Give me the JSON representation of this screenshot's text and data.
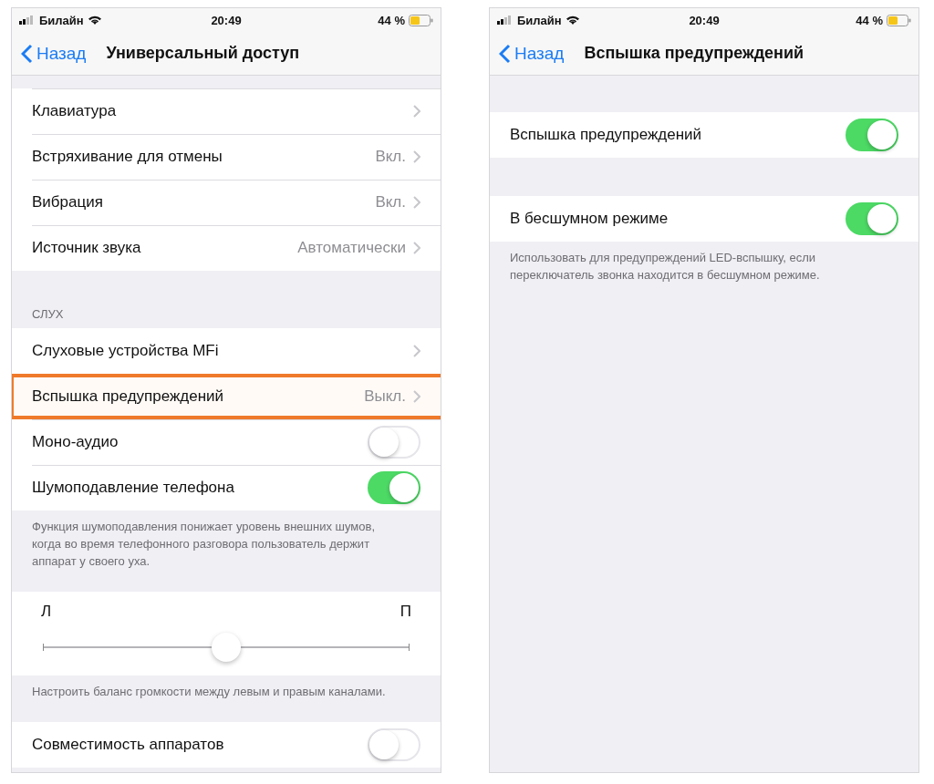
{
  "screens": [
    {
      "status_bar": {
        "carrier": "Билайн",
        "time": "20:49",
        "battery": "44 %"
      },
      "nav": {
        "back": "Назад",
        "title": "Универсальный доступ"
      },
      "sections": [
        {
          "rows": [
            {
              "kind": "link",
              "label": "Клавиатура",
              "highlighted": false
            },
            {
              "kind": "link",
              "label": "Встряхивание для отмены",
              "value": "Вкл.",
              "highlighted": false
            },
            {
              "kind": "link",
              "label": "Вибрация",
              "value": "Вкл.",
              "highlighted": false
            },
            {
              "kind": "link",
              "label": "Источник звука",
              "value": "Автоматически",
              "highlighted": false
            }
          ]
        },
        {
          "header": "СЛУХ",
          "rows": [
            {
              "kind": "link",
              "label": "Слуховые устройства MFi",
              "highlighted": false
            },
            {
              "kind": "link",
              "label": "Вспышка предупреждений",
              "value": "Выкл.",
              "highlighted": true
            },
            {
              "kind": "toggle",
              "label": "Моно-аудио",
              "on": false
            },
            {
              "kind": "toggle",
              "label": "Шумоподавление телефона",
              "on": true
            }
          ],
          "footer": "Функция шумоподавления понижает уровень внешних шумов, когда во время телефонного разговора пользователь держит аппарат у своего уха."
        },
        {
          "slider": {
            "left": "Л",
            "right": "П",
            "level": 0.5
          },
          "footer": "Настроить баланс громкости между левым и правым каналами."
        },
        {
          "rows": [
            {
              "kind": "toggle",
              "label": "Совместимость аппаратов",
              "on": false
            }
          ]
        }
      ]
    },
    {
      "status_bar": {
        "carrier": "Билайн",
        "time": "20:49",
        "battery": "44 %"
      },
      "nav": {
        "back": "Назад",
        "title": "Вспышка предупреждений"
      },
      "sections": [
        {
          "rows": [
            {
              "kind": "toggle",
              "label": "Вспышка предупреждений",
              "on": true
            }
          ]
        },
        {
          "rows": [
            {
              "kind": "toggle",
              "label": "В бесшумном режиме",
              "on": true
            }
          ],
          "footer": "Использовать для предупреждений LED-вспышку, если переключатель звонка находится в бесшумном режиме."
        }
      ]
    }
  ]
}
